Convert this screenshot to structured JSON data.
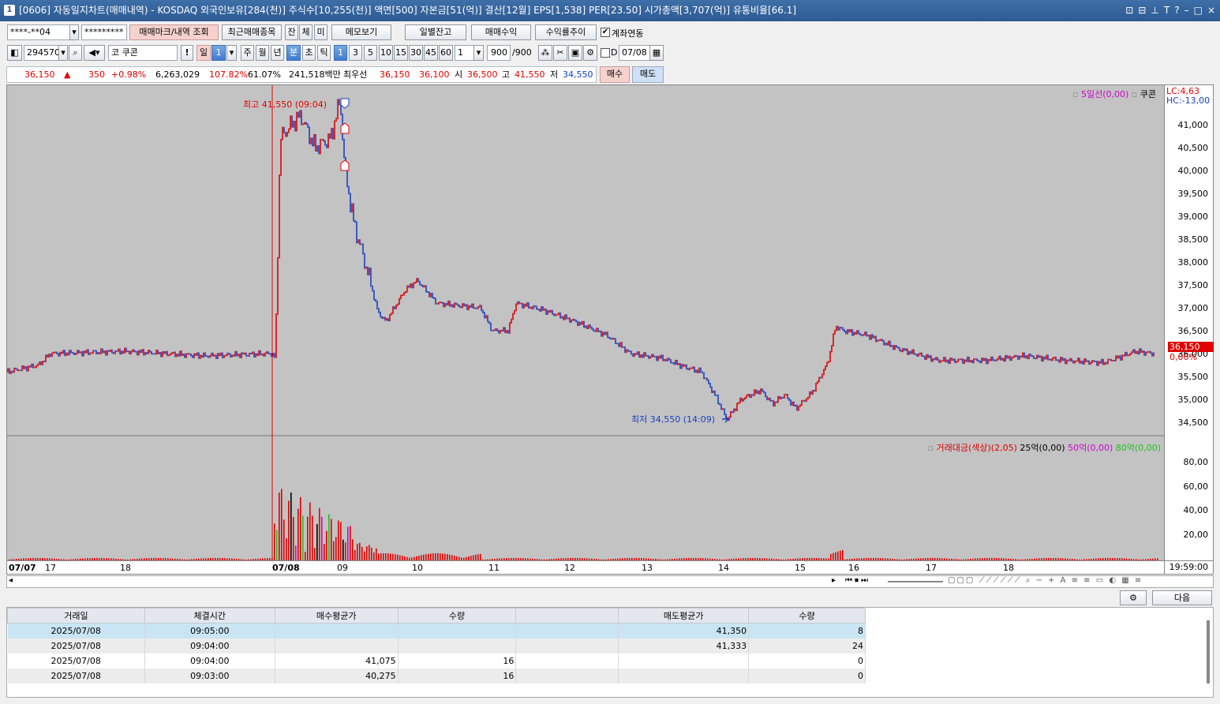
{
  "window": {
    "icon": "1",
    "title": "[0606] 자동일지차트(매매내역) - KOSDAQ 외국인보유[284(천)] 주식수[10,255(천)] 액면[500] 자본금[51(억)] 결산[12월] EPS[1,538] PER[23.50] 시가총액[3,707(억)] 유통비율[66.1]",
    "controls": [
      "⊡",
      "⊟",
      "⊥",
      "T",
      "?",
      "–",
      "□",
      "×"
    ]
  },
  "toolbar1": {
    "account": "****-**04",
    "password": "*********",
    "btn_mark": "매매마크/내역 조회",
    "btn_recent": "최근매매종목",
    "btn_jan": "잔",
    "btn_che": "체",
    "btn_mi": "미",
    "btn_memo": "메모보기",
    "btn_daily": "일별잔고",
    "btn_profit": "매매수익",
    "btn_rate": "수익률추이",
    "link_label": "계좌연동",
    "link_checked": "✔"
  },
  "toolbar2": {
    "code": "294570",
    "prefix": "코",
    "name": "쿠콘",
    "bang": "!",
    "period": [
      "일",
      "1",
      "주",
      "월",
      "년",
      "분",
      "초",
      "틱"
    ],
    "minutes": [
      "1",
      "3",
      "5",
      "10",
      "15",
      "30",
      "45",
      "60"
    ],
    "unit": "1",
    "count": "900",
    "count_total": "/900",
    "date_chk_label": "D",
    "date": "07/08"
  },
  "quote": {
    "price": "36,150",
    "arrow": "▲",
    "change": "350",
    "rate": "+0.98%",
    "volume": "6,263,029",
    "vol_ratio": "107.82%",
    "turnover": "61.07%",
    "amount": "241,518백만",
    "bid_label": "최우선",
    "ask": "36,150",
    "bid": "36,100",
    "open_label": "시",
    "open": "36,500",
    "high_label": "고",
    "high": "41,550",
    "low_label": "저",
    "low": "34,550",
    "buy": "매수",
    "sell": "매도"
  },
  "chart": {
    "legend_ma": "5일선(0,00)",
    "legend_name": "쿠콘",
    "lc": "LC:4,63",
    "hc": "HC:-13,00",
    "high_note": "최고 41,550 (09:04)",
    "low_note": "최저 34,550 (14:09)",
    "last_price": "36,150",
    "last_rate": "0,00%",
    "price_ticks": [
      "41,000",
      "40,500",
      "40,000",
      "39,500",
      "39,000",
      "38,500",
      "38,000",
      "37,500",
      "37,000",
      "36,500",
      "36,000",
      "35,500",
      "35,000",
      "34,500"
    ],
    "vol_legend": [
      "거래대금(색상)(2,05)",
      "25억(0,00)",
      "50억(0,00)",
      "80억(0,00)"
    ],
    "vol_ticks": [
      "80,00",
      "60,00",
      "40,00",
      "20,00"
    ],
    "dates": [
      "07/07",
      "17",
      "18",
      "07/08",
      "09",
      "10",
      "11",
      "12",
      "13",
      "14",
      "15",
      "16",
      "17",
      "18"
    ],
    "time_label": "19:59:00",
    "colors": {
      "up": "#e00000",
      "down": "#1a3fbf",
      "bg": "#c3c3c3"
    }
  },
  "bottom": {
    "next": "다음",
    "headers": [
      "거래일",
      "체결시간",
      "매수평균가",
      "수량",
      "",
      "매도평균가",
      "수량"
    ],
    "rows": [
      [
        "2025/07/08",
        "09:05:00",
        "",
        "",
        "",
        "41,350",
        "8"
      ],
      [
        "2025/07/08",
        "09:04:00",
        "",
        "",
        "",
        "41,333",
        "24"
      ],
      [
        "2025/07/08",
        "09:04:00",
        "41,075",
        "16",
        "",
        "",
        "0"
      ],
      [
        "2025/07/08",
        "09:03:00",
        "40,275",
        "16",
        "",
        "",
        "0"
      ]
    ]
  }
}
